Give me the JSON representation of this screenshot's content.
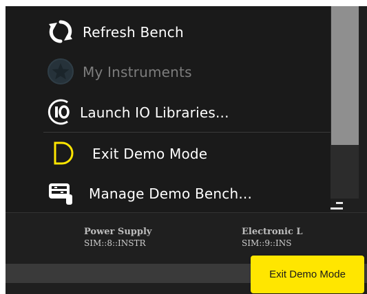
{
  "menu": {
    "items": [
      {
        "label": "Refresh Bench",
        "icon": "refresh-icon",
        "enabled": true
      },
      {
        "label": "My Instruments",
        "icon": "star-icon",
        "enabled": false
      },
      {
        "label": "Launch IO Libraries...",
        "icon": "io-libraries-icon",
        "enabled": true
      },
      {
        "label": "Exit Demo Mode",
        "icon": "demo-mode-icon",
        "enabled": true
      },
      {
        "label": "Manage Demo Bench...",
        "icon": "manage-bench-icon",
        "enabled": true
      }
    ]
  },
  "bench": {
    "devices": [
      {
        "name": "Power Supply",
        "address": "SIM::8::INSTR"
      },
      {
        "name": "Electronic L",
        "address": "SIM::9::INS"
      }
    ]
  },
  "tooltip": {
    "text": "Exit Demo Mode"
  },
  "colors": {
    "accent_yellow": "#ffe600",
    "menu_background": "#1a1a1a",
    "scroll_thumb": "#8f8f8f"
  }
}
